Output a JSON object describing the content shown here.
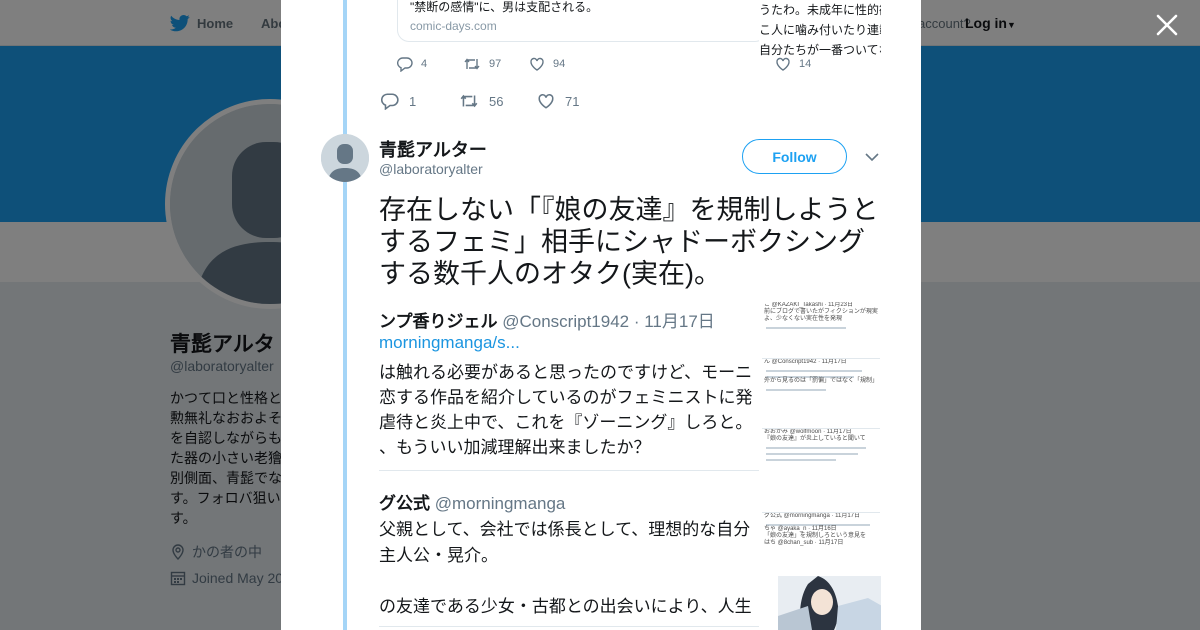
{
  "background": {
    "nav": {
      "home": "Home",
      "about": "Abo",
      "account": "account?",
      "login": "Log in"
    },
    "profile": {
      "name": "青髭アルタ",
      "handle": "@laboratoryalter",
      "bio": [
        "かつて口と性格と",
        "勲無礼なおおよそ",
        "を自認しながらも",
        "た器の小さい老獪",
        "別側面、青髭でな",
        "す。フォロバ狙い",
        "す。"
      ],
      "location": "かの者の中",
      "joined": "Joined May 20"
    },
    "colors": {
      "banner": "#1da1f2",
      "page": "#e6ecf0"
    }
  },
  "modal": {
    "quoted": {
      "line": "\"禁断の感情\"に、男は支配される。",
      "domain": "comic-days.com",
      "replies": "4",
      "retweets": "97",
      "likes": "94"
    },
    "fragment": {
      "lines": [
        "うたわ。未成年に性的欲",
        "こ人に噛み付いたり連載",
        "自分たちが一番ついてな"
      ],
      "likes": "14"
    },
    "parent_actions": {
      "replies": "1",
      "retweets": "56",
      "likes": "71"
    },
    "tweet": {
      "display_name": "青髭アルター",
      "handle": "@laboratoryalter",
      "follow_label": "Follow",
      "text": "存在しない「『娘の友達』を規制しようとするフェミ」相手にシャドーボクシングする数千人のオタク(実在)。"
    },
    "media": {
      "lines": [
        {
          "name": "ンプ香りジェル",
          "handle": "@Conscript1942",
          "date": "· 11月17日"
        },
        {
          "link": "morningmanga/s..."
        },
        {
          "text": "は触れる必要があると思ったのですけど、モーニ"
        },
        {
          "text": "恋する作品を紹介しているのがフェミニストに発"
        },
        {
          "text": "虐待と炎上中で、これを『ゾーニング』しろと。"
        },
        {
          "text": "、もういい加減理解出来ましたか？"
        },
        {
          "name": "グ公式",
          "handle": "@morningmanga"
        },
        {
          "text": "父親として、会社では係長として、理想的な自分"
        },
        {
          "text": "主人公・晃介。"
        },
        {
          "text": "の友達である少女・古都との出会いにより、人生"
        }
      ],
      "side": [
        "こ @KAZAKI_Takashi · 11月23日",
        "前にブログで書いたがフィクションが現実",
        "よ、少なくない実在性を発現",
        "ん @Conscript1942 · 11月17日",
        "外から見るのは「罰偏」ではなく「規制」",
        "おおかみ @wolfmoon · 11月17日",
        "『娘の友達』が炎上していると聞いて",
        "グ公式 @morningmanga · 11月17日",
        "ちゃ @ayaka_n · 11月16日",
        "「娘の友達」を規制しろという意見を",
        "はち @8chan_sub · 11月17日"
      ]
    }
  }
}
